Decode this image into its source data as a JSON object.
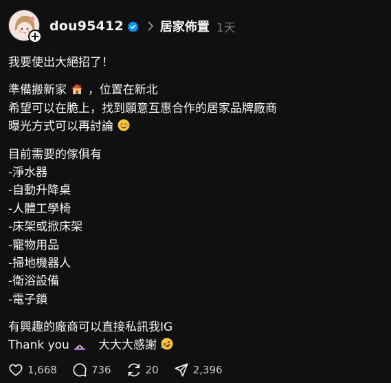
{
  "post": {
    "username": "dou95412",
    "topic": "居家佈置",
    "time": "1天",
    "lines": [
      "我要使出大絕招了！",
      "準備搬新家",
      "，位置在新北",
      "希望可以在脆上，找到願意互惠合作的居家品牌廠商",
      "曝光方式可以再討論",
      "目前需要的傢俱有",
      "-淨水器",
      "-自動升降桌",
      "-人體工學椅",
      "-床架或掀床架",
      "-寵物用品",
      "-掃地機器人",
      "-衛浴設備",
      "-電子鎖",
      "有興趣的廠商可以直接私訊我IG",
      "Thank you",
      "大大大感謝"
    ]
  },
  "icons": {
    "verified": "verified-badge-icon",
    "chevron": "chevron-right-icon",
    "house": "house-emoji-icon",
    "smile": "smiling-face-emoji-icon",
    "pray": "folded-hands-emoji-icon",
    "rofl": "rolling-laughing-emoji-icon",
    "like": "heart-icon",
    "comment": "comment-icon",
    "repost": "repost-icon",
    "share": "share-icon"
  },
  "stats": {
    "likes": "1,668",
    "comments": "736",
    "reposts": "20",
    "shares": "2,396"
  },
  "colors": {
    "background": "#101010",
    "text": "#f3f5f7",
    "muted": "#777777",
    "verified": "#0095f6"
  }
}
